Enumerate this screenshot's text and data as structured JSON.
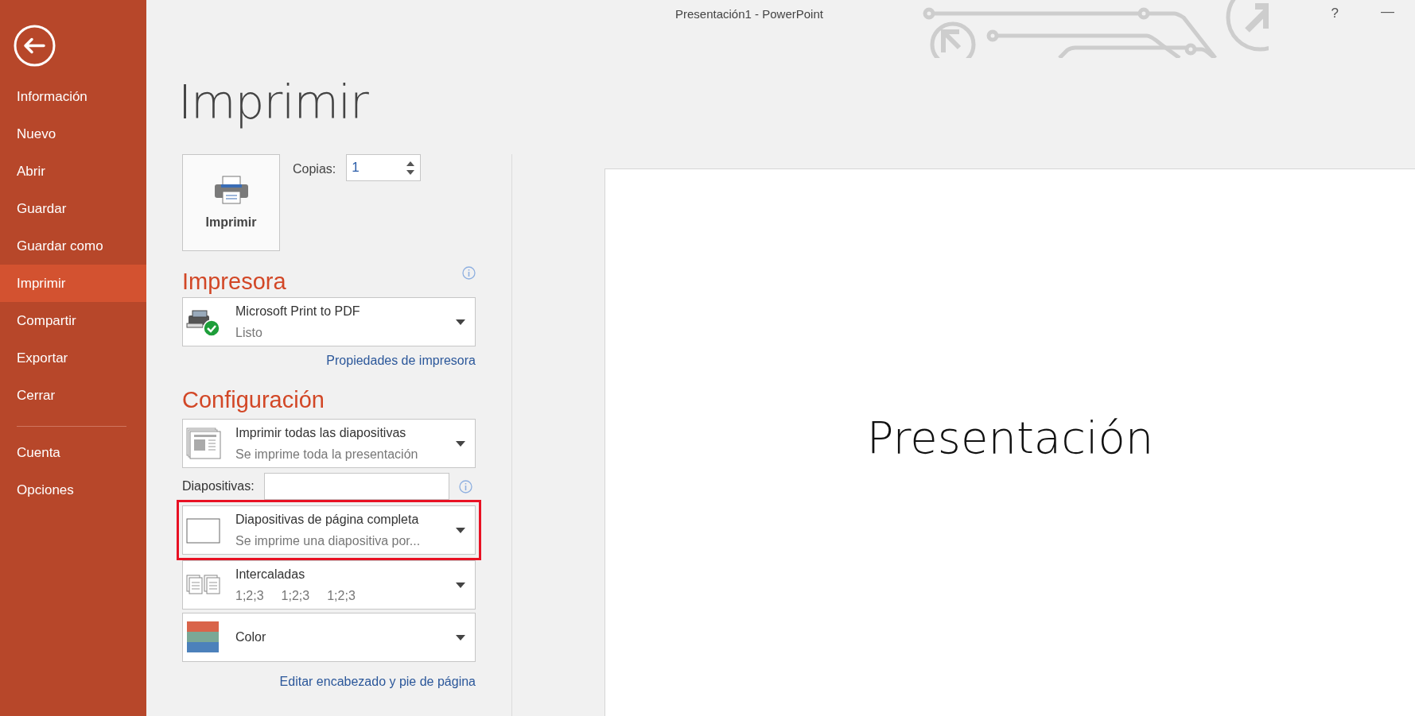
{
  "window": {
    "title": "Presentación1 - PowerPoint",
    "help": "?",
    "minimize": "—"
  },
  "sidebar": {
    "items": [
      {
        "label": "Información",
        "selected": false
      },
      {
        "label": "Nuevo",
        "selected": false
      },
      {
        "label": "Abrir",
        "selected": false
      },
      {
        "label": "Guardar",
        "selected": false
      },
      {
        "label": "Guardar como",
        "selected": false
      },
      {
        "label": "Imprimir",
        "selected": true
      },
      {
        "label": "Compartir",
        "selected": false
      },
      {
        "label": "Exportar",
        "selected": false
      },
      {
        "label": "Cerrar",
        "selected": false
      }
    ],
    "bottom_items": [
      {
        "label": "Cuenta",
        "selected": false
      },
      {
        "label": "Opciones",
        "selected": false
      }
    ]
  },
  "page_title": "Imprimir",
  "print_button": {
    "label": "Imprimir"
  },
  "copies": {
    "label": "Copias:",
    "value": "1"
  },
  "printer": {
    "heading": "Impresora",
    "name": "Microsoft Print to PDF",
    "status": "Listo",
    "properties_link": "Propiedades de impresora"
  },
  "settings": {
    "heading": "Configuración",
    "range": {
      "kind": "slides-stack",
      "title": "Imprimir todas las diapositivas",
      "details": [
        "Se imprime toda la presentación"
      ],
      "highlighted": false
    },
    "slides_field": {
      "label": "Diapositivas:"
    },
    "options": [
      {
        "kind": "full-page",
        "title": "Diapositivas de página completa",
        "details": [
          "Se imprime una diapositiva por..."
        ],
        "highlighted": true
      },
      {
        "kind": "collated",
        "title": "Intercaladas",
        "details": [
          "1;2;3",
          "1;2;3",
          "1;2;3"
        ],
        "highlighted": false
      },
      {
        "kind": "color",
        "title": "Color",
        "highlighted": false
      }
    ]
  },
  "edit_link": "Editar encabezado y pie de página",
  "preview": {
    "slide_title": "Presentación"
  }
}
